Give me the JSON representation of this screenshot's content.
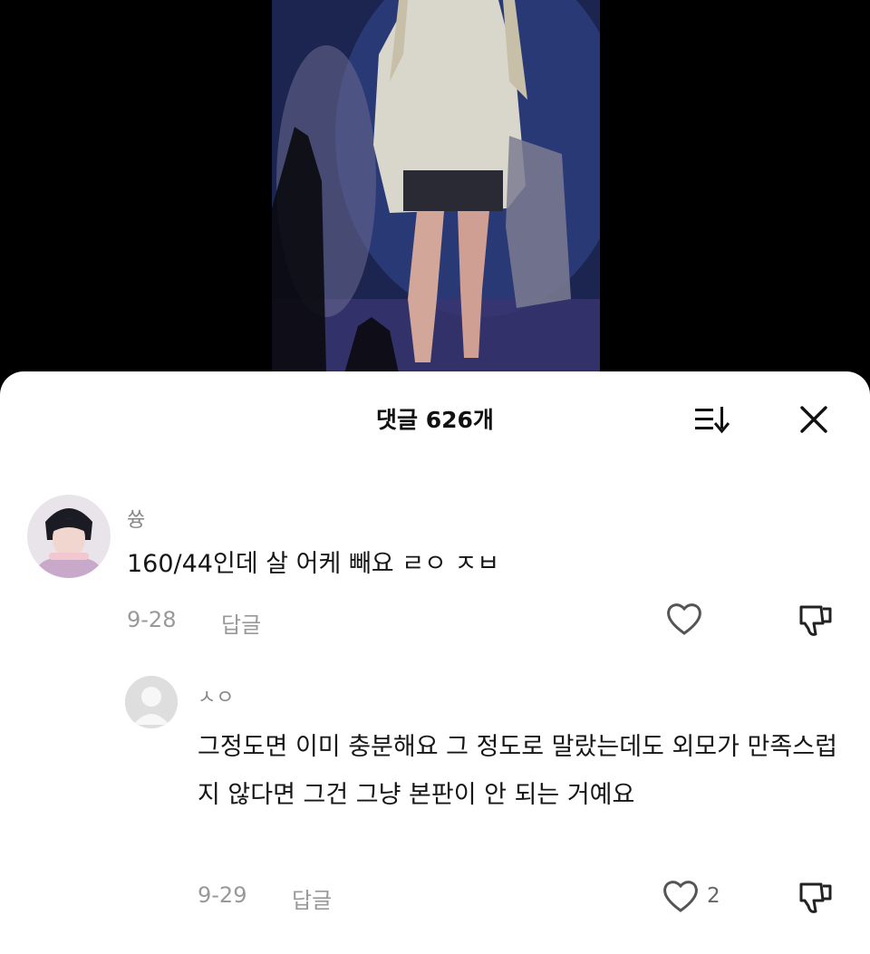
{
  "sheet": {
    "title": "댓글 626개"
  },
  "comments": [
    {
      "username": "쓩",
      "text": "160/44인데 살 어케 빼요 ㄹㅇ ㅈㅂ",
      "date": "9-28",
      "reply_label": "답글",
      "avatar_icon": "user-photo-avatar",
      "like_count": ""
    },
    {
      "username": "ㅅㅇ",
      "text": "그정도면 이미 충분해요 그 정도로 말랐는데도 외모가 만족스럽지 않다면 그건 그냥 본판이 안 되는 거예요",
      "date": "9-29",
      "reply_label": "답글",
      "avatar_icon": "default-user-avatar",
      "like_count": "2"
    }
  ],
  "icons": {
    "sort": "sort-icon",
    "close": "close-icon",
    "like": "heart-icon",
    "dislike": "thumbs-down-icon"
  }
}
